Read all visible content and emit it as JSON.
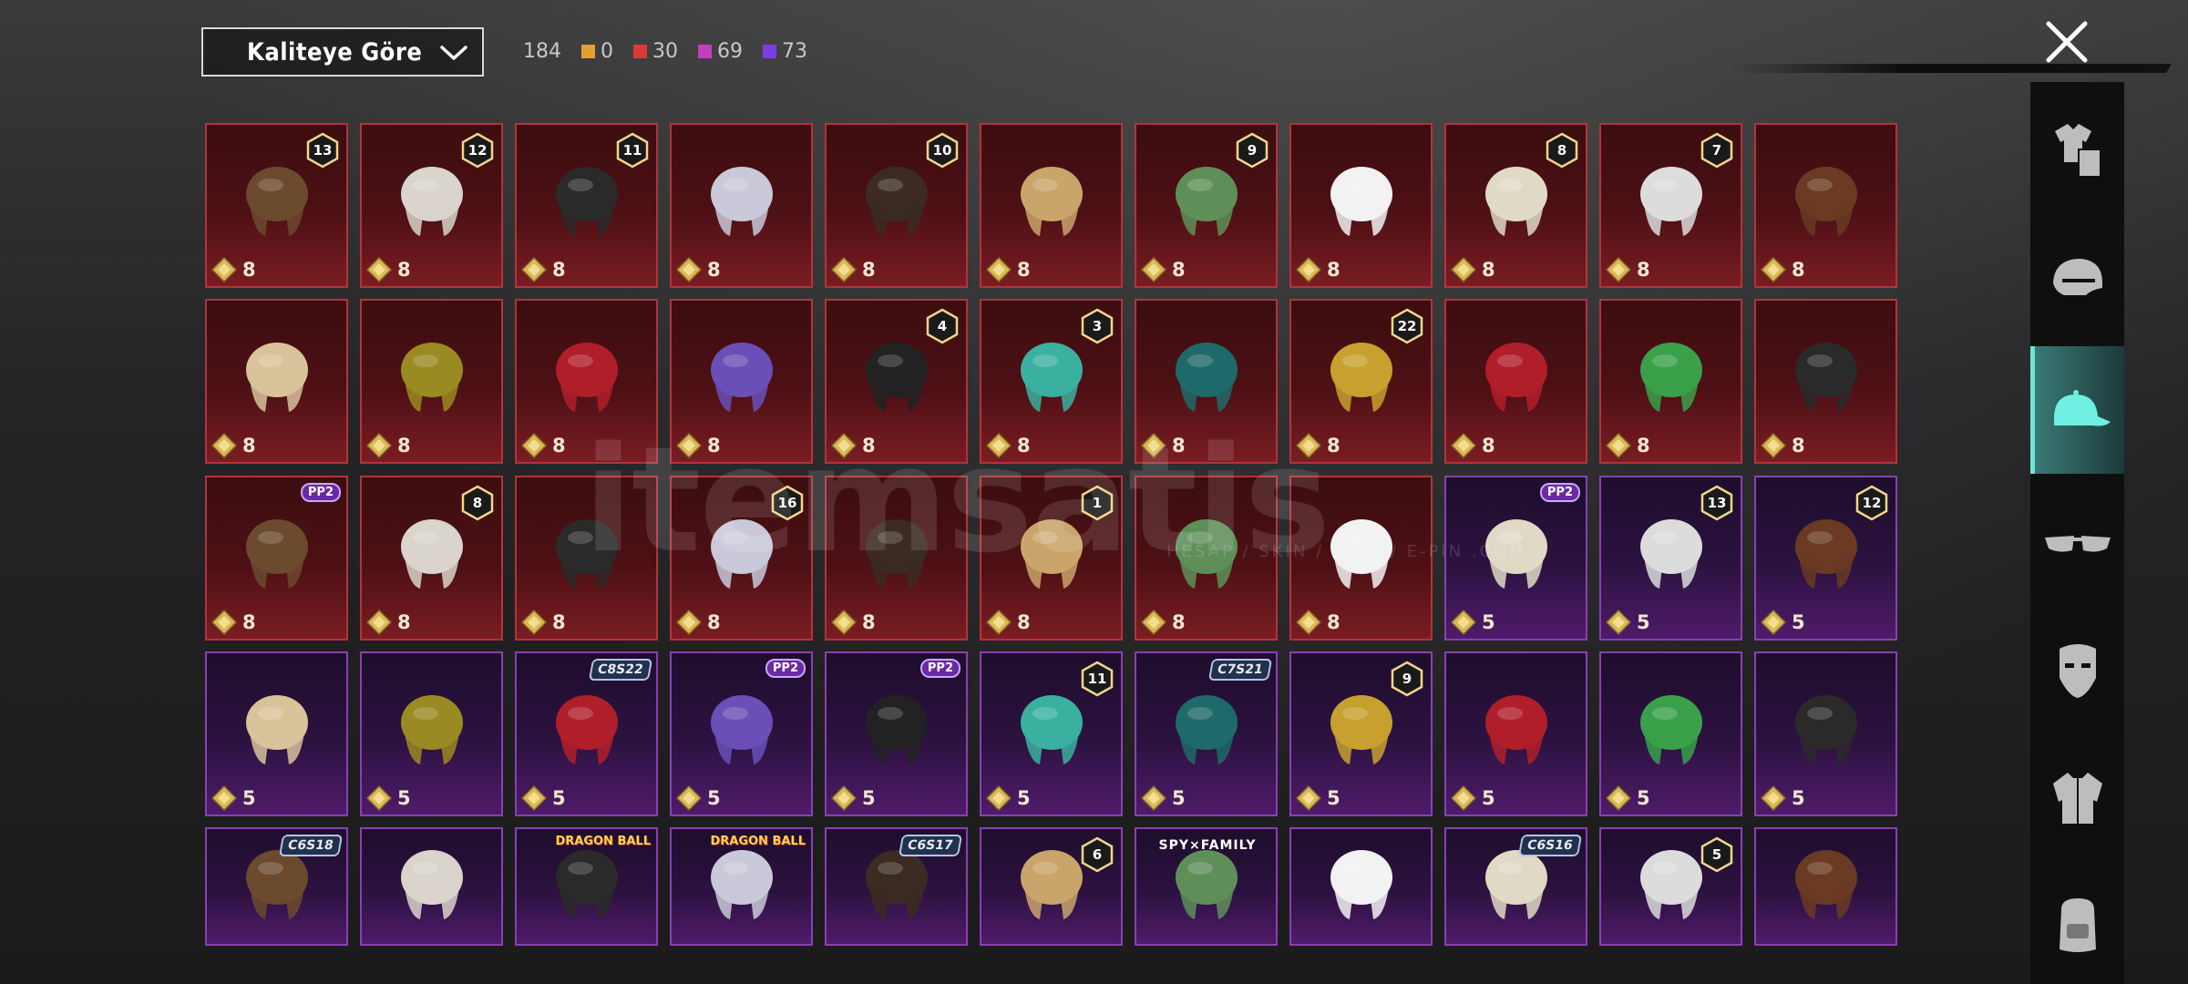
{
  "sort": {
    "label": "Kaliteye Göre"
  },
  "counts": {
    "total": "184",
    "items": [
      {
        "color": "#e1a032",
        "value": "0"
      },
      {
        "color": "#d93a3a",
        "value": "30"
      },
      {
        "color": "#c23fc0",
        "value": "69"
      },
      {
        "color": "#7a3fe0",
        "value": "73"
      }
    ]
  },
  "watermark": {
    "brand": "itemsatis",
    "sub": "HESAP / SKIN / ITEM / E-PIN .COM"
  },
  "sidebar": {
    "items": [
      {
        "icon": "outfit-icon"
      },
      {
        "icon": "helmet-icon"
      },
      {
        "icon": "cap-icon",
        "selected": true
      },
      {
        "icon": "glasses-icon"
      },
      {
        "icon": "mask-icon"
      },
      {
        "icon": "jacket-icon"
      },
      {
        "icon": "backpack-icon"
      }
    ]
  },
  "grid": {
    "rows": [
      [
        {
          "rarity": "red",
          "price": "8",
          "badge": "13",
          "icon": "flower-hat-icon"
        },
        {
          "rarity": "red",
          "price": "8",
          "badge": "12",
          "icon": "white-hair-icon"
        },
        {
          "rarity": "red",
          "price": "8",
          "badge": "11",
          "icon": "black-helmet-icon"
        },
        {
          "rarity": "red",
          "price": "8",
          "badge": "",
          "icon": "ghost-hair-icon"
        },
        {
          "rarity": "red",
          "price": "8",
          "badge": "10",
          "icon": "braided-hair-icon"
        },
        {
          "rarity": "red",
          "price": "8",
          "badge": "",
          "icon": "skull-mask-icon"
        },
        {
          "rarity": "red",
          "price": "8",
          "badge": "9",
          "icon": "zombie-head-icon"
        },
        {
          "rarity": "red",
          "price": "8",
          "badge": "",
          "icon": "cowboy-hat-icon"
        },
        {
          "rarity": "red",
          "price": "8",
          "badge": "8",
          "icon": "winged-hair-icon"
        },
        {
          "rarity": "red",
          "price": "8",
          "badge": "7",
          "icon": "silver-hair-icon"
        },
        {
          "rarity": "red",
          "price": "8",
          "badge": "",
          "icon": "cat-ear-hair-icon"
        }
      ],
      [
        {
          "rarity": "red",
          "price": "8",
          "badge": "",
          "icon": "blonde-hair-icon"
        },
        {
          "rarity": "red",
          "price": "8",
          "badge": "",
          "icon": "golden-mask-icon"
        },
        {
          "rarity": "red",
          "price": "8",
          "badge": "",
          "icon": "red-helmet-icon"
        },
        {
          "rarity": "red",
          "price": "8",
          "badge": "",
          "icon": "purple-pigtails-icon"
        },
        {
          "rarity": "red",
          "price": "8",
          "badge": "4",
          "icon": "snowman-hat-icon"
        },
        {
          "rarity": "red",
          "price": "8",
          "badge": "3",
          "icon": "joker-hair-icon"
        },
        {
          "rarity": "red",
          "price": "8",
          "badge": "",
          "icon": "dragon-helmet-icon"
        },
        {
          "rarity": "red",
          "price": "8",
          "badge": "22",
          "icon": "gold-helmet-icon"
        },
        {
          "rarity": "red",
          "price": "8",
          "badge": "",
          "icon": "demon-helmet-icon"
        },
        {
          "rarity": "red",
          "price": "8",
          "badge": "",
          "icon": "green-crown-icon"
        },
        {
          "rarity": "red",
          "price": "8",
          "badge": "",
          "icon": "dark-helmet-icon"
        }
      ],
      [
        {
          "rarity": "red",
          "price": "8",
          "tag": "PP2",
          "icon": "bonnet-icon"
        },
        {
          "rarity": "red",
          "price": "8",
          "badge": "8",
          "icon": "red-hat-icon"
        },
        {
          "rarity": "red",
          "price": "8",
          "badge": "",
          "icon": "purple-bandana-icon"
        },
        {
          "rarity": "red",
          "price": "8",
          "badge": "16",
          "icon": "purple-visor-icon"
        },
        {
          "rarity": "red",
          "price": "8",
          "badge": "",
          "icon": "feather-ears-icon"
        },
        {
          "rarity": "red",
          "price": "8",
          "badge": "1",
          "icon": "blue-mask-icon"
        },
        {
          "rarity": "red",
          "price": "8",
          "badge": "",
          "icon": "clown-hair-icon"
        },
        {
          "rarity": "red",
          "price": "8",
          "badge": "",
          "icon": "pirate-hat-icon"
        },
        {
          "rarity": "pur",
          "price": "5",
          "tag": "PP2",
          "icon": "gas-mask-icon"
        },
        {
          "rarity": "pur",
          "price": "5",
          "badge": "13",
          "icon": "goggle-hat-icon"
        },
        {
          "rarity": "pur",
          "price": "5",
          "badge": "12",
          "icon": "orange-hair-icon"
        }
      ],
      [
        {
          "rarity": "pur",
          "price": "5",
          "badge": "",
          "icon": "pink-hair-icon"
        },
        {
          "rarity": "pur",
          "price": "5",
          "badge": "",
          "icon": "blue-ponytail-icon"
        },
        {
          "rarity": "pur",
          "price": "5",
          "season": "C8S22",
          "icon": "magenta-hair-icon"
        },
        {
          "rarity": "pur",
          "price": "5",
          "tag": "PP2",
          "icon": "red-hair-icon"
        },
        {
          "rarity": "pur",
          "price": "5",
          "tag": "PP2",
          "icon": "panda-head-icon"
        },
        {
          "rarity": "pur",
          "price": "5",
          "badge": "11",
          "icon": "flower-crown-icon"
        },
        {
          "rarity": "pur",
          "price": "5",
          "season": "C7S21",
          "icon": "white-hair-icon"
        },
        {
          "rarity": "pur",
          "price": "5",
          "badge": "9",
          "icon": "brown-hair-icon"
        },
        {
          "rarity": "pur",
          "price": "5",
          "badge": "",
          "icon": "shark-hat-icon"
        },
        {
          "rarity": "pur",
          "price": "5",
          "badge": "",
          "icon": "grey-hair-icon"
        },
        {
          "rarity": "pur",
          "price": "5",
          "badge": "",
          "icon": "hooded-hair-icon"
        }
      ],
      [
        {
          "rarity": "pur",
          "price": "",
          "season": "C6S18",
          "icon": "brown-bob-icon"
        },
        {
          "rarity": "pur",
          "price": "",
          "badge": "",
          "icon": "space-helmet-icon"
        },
        {
          "rarity": "pur",
          "price": "",
          "brand": "DRAGON BALL",
          "icon": "green-beanie-icon"
        },
        {
          "rarity": "pur",
          "price": "",
          "brand": "DRAGON BALL",
          "icon": "blue-hair-icon"
        },
        {
          "rarity": "pur",
          "price": "",
          "season": "C6S17",
          "icon": "visor-cap-icon"
        },
        {
          "rarity": "pur",
          "price": "",
          "badge": "6",
          "icon": "robot-helmet-icon"
        },
        {
          "rarity": "pur",
          "price": "",
          "spy": "SPY×FAMILY",
          "icon": "pink-bob-icon"
        },
        {
          "rarity": "pur",
          "price": "",
          "badge": "",
          "icon": "top-hat-icon"
        },
        {
          "rarity": "pur",
          "price": "",
          "season": "C6S16",
          "icon": "red-bob-icon"
        },
        {
          "rarity": "pur",
          "price": "",
          "badge": "5",
          "icon": "bunny-ears-icon"
        },
        {
          "rarity": "pur",
          "price": "",
          "badge": "",
          "icon": "curly-blonde-icon"
        }
      ]
    ]
  }
}
